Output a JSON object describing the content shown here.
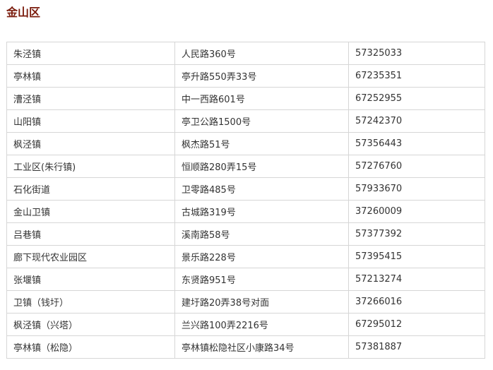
{
  "title": "金山区",
  "rows": [
    {
      "name": "朱泾镇",
      "address": "人民路360号",
      "phone": "57325033"
    },
    {
      "name": "亭林镇",
      "address": "亭升路550弄33号",
      "phone": "67235351"
    },
    {
      "name": "漕泾镇",
      "address": "中一西路601号",
      "phone": "67252955"
    },
    {
      "name": "山阳镇",
      "address": "亭卫公路1500号",
      "phone": "57242370"
    },
    {
      "name": "枫泾镇",
      "address": "枫杰路51号",
      "phone": "57356443"
    },
    {
      "name": "工业区(朱行镇)",
      "address": "恒顺路280弄15号",
      "phone": "57276760"
    },
    {
      "name": "石化街道",
      "address": "卫零路485号",
      "phone": "57933670"
    },
    {
      "name": "金山卫镇",
      "address": "古城路319号",
      "phone": "37260009"
    },
    {
      "name": "吕巷镇",
      "address": "溪南路58号",
      "phone": "57377392"
    },
    {
      "name": "廊下现代农业园区",
      "address": "景乐路228号",
      "phone": "57395415"
    },
    {
      "name": "张堰镇",
      "address": "东贤路951号",
      "phone": "57213274"
    },
    {
      "name": "卫镇（钱圩）",
      "address": "建圩路20弄38号对面",
      "phone": "37266016"
    },
    {
      "name": "枫泾镇（兴塔）",
      "address": "兰兴路100弄2216号",
      "phone": "67295012"
    },
    {
      "name": "亭林镇（松隐）",
      "address": "亭林镇松隐社区小康路34号",
      "phone": "57381887"
    }
  ]
}
